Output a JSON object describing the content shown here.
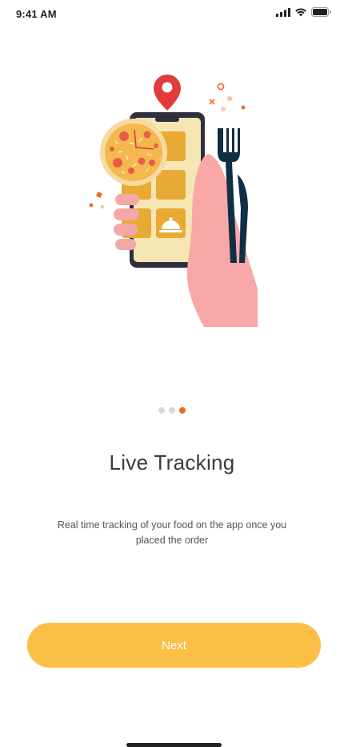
{
  "status_bar": {
    "time": "9:41 AM"
  },
  "onboarding": {
    "page_indicator": {
      "total": 3,
      "active_index": 2
    },
    "title": "Live Tracking",
    "description": "Real time tracking of your food on the app once you placed the order",
    "next_label": "Next"
  },
  "colors": {
    "accent": "#fcbf46",
    "active_dot": "#f26b1d",
    "pin": "#e23b3b"
  }
}
